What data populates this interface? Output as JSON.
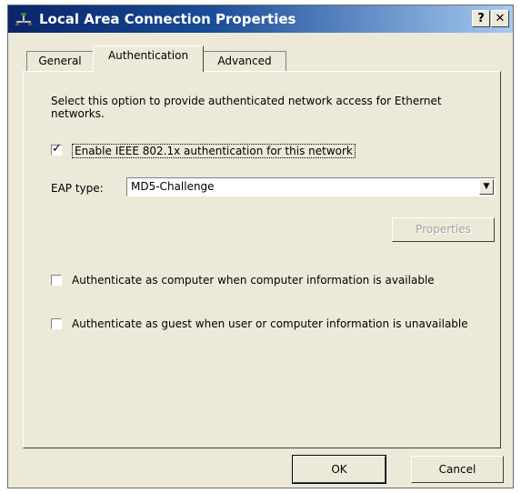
{
  "window": {
    "title": "Local Area Connection Properties",
    "help_label": "?",
    "close_label": "✕"
  },
  "tabs": [
    {
      "label": "General",
      "active": false
    },
    {
      "label": "Authentication",
      "active": true
    },
    {
      "label": "Advanced",
      "active": false
    }
  ],
  "authentication": {
    "description": "Select this option to provide authenticated network access for Ethernet networks.",
    "enable_ieee": {
      "label": "Enable IEEE 802.1x authentication for this network",
      "checked": true
    },
    "eap_label": "EAP type:",
    "eap_value": "MD5-Challenge",
    "properties_label": "Properties",
    "auth_computer": {
      "label": "Authenticate as computer when computer information is available",
      "checked": false
    },
    "auth_guest": {
      "label": "Authenticate as guest when user or computer information is unavailable",
      "checked": false
    }
  },
  "buttons": {
    "ok": "OK",
    "cancel": "Cancel"
  },
  "icons": {
    "title": "network-connection-icon",
    "dropdown": "chevron-down-icon",
    "check": "checkmark-icon"
  },
  "colors": {
    "titlebar_start": "#0a246a",
    "titlebar_end": "#a6caf0",
    "dialog_bg": "#ece9d8",
    "disabled_text": "#a0a0a0"
  }
}
